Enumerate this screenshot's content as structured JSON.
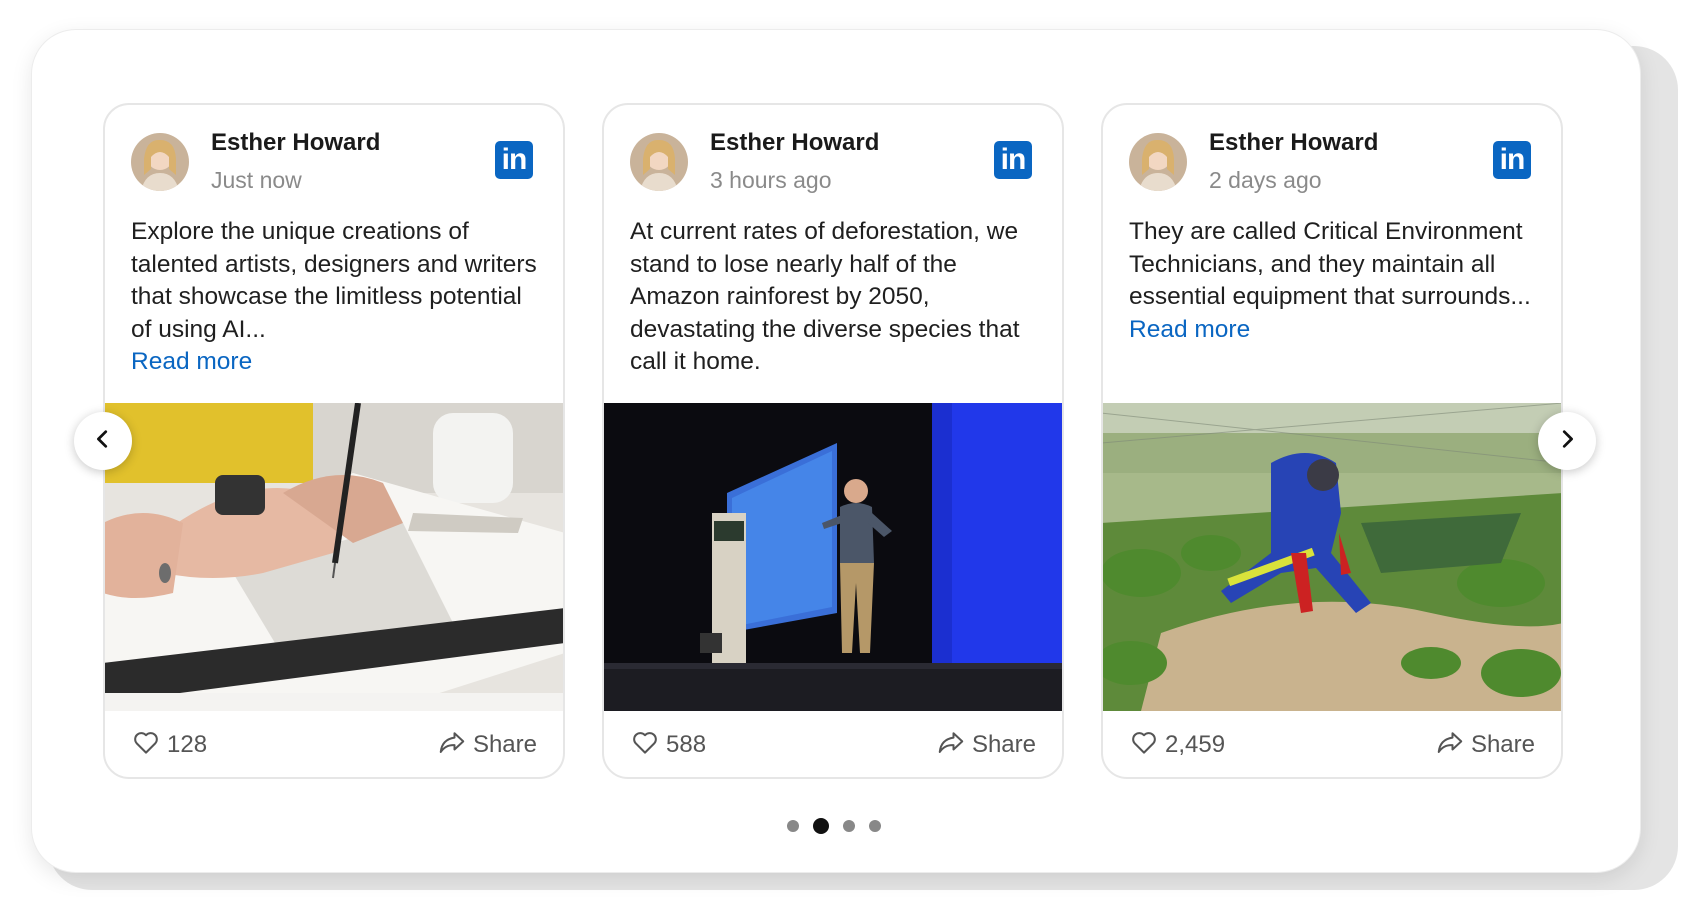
{
  "colors": {
    "accent": "#0a66c2",
    "linkedin_brand": "#0a66c2",
    "text_primary": "#1f1f1f",
    "text_secondary": "#8a8a8a",
    "active_dot": "#111111",
    "inactive_dot": "#888888"
  },
  "carousel": {
    "prev_icon": "chevron-left-icon",
    "next_icon": "chevron-right-icon",
    "page_count": 4,
    "active_page": 2
  },
  "cards": [
    {
      "author": "Esther Howard",
      "time": "Just now",
      "text": "Explore the unique creations of talented artists, designers and writers that showcase the limitless potential of using AI...",
      "read_more": "Read more",
      "image_icon": "drawing-hand-photo",
      "likes": "128",
      "share": "Share",
      "brand_label": "in"
    },
    {
      "author": "Esther Howard",
      "time": "3 hours ago",
      "text": "At current rates of deforestation, we stand to lose nearly half of the Amazon rainforest by 2050, devastating the diverse species that call it home.",
      "read_more": "",
      "image_icon": "stage-speaker-photo",
      "likes": "588",
      "share": "Share",
      "brand_label": "in"
    },
    {
      "author": "Esther Howard",
      "time": "2 days ago",
      "text": "They are called Critical Environment Technicians, and they maintain all essential equipment that surrounds...",
      "read_more": "Read more",
      "image_icon": "field-worker-photo",
      "likes": "2,459",
      "share": "Share",
      "brand_label": "in"
    }
  ]
}
